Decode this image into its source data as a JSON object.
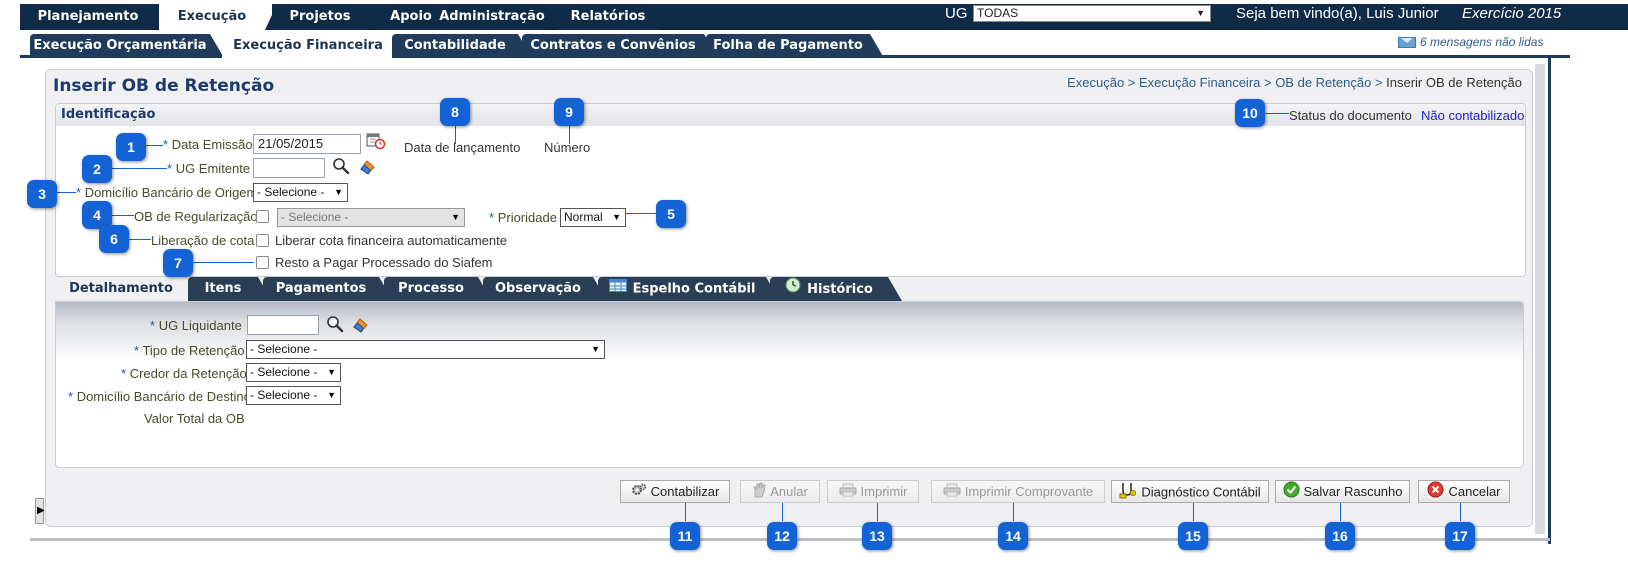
{
  "main_tabs": [
    {
      "label": "Planejamento"
    },
    {
      "label": "Execução",
      "active": true
    },
    {
      "label": "Projetos"
    },
    {
      "label": "Apoio"
    },
    {
      "label": "Administração"
    },
    {
      "label": "Relatórios"
    }
  ],
  "header": {
    "ug_label": "UG",
    "ug_value": "TODAS",
    "welcome": "Seja bem vindo(a), Luis Junior",
    "exercicio": "Exercício 2015",
    "messages": "6 mensagens não lidas"
  },
  "sub_tabs": [
    {
      "label": "Execução Orçamentária"
    },
    {
      "label": "Execução Financeira",
      "active": true
    },
    {
      "label": "Contabilidade"
    },
    {
      "label": "Contratos e Convênios"
    },
    {
      "label": "Folha de Pagamento"
    }
  ],
  "page": {
    "title": "Inserir OB de Retenção",
    "breadcrumb_links": "Execução > Execução Financeira > OB de Retenção > ",
    "breadcrumb_current": "Inserir OB de Retenção"
  },
  "identificacao": {
    "title": "Identificação",
    "data_emissao_label": "Data Emissão",
    "data_emissao_value": "21/05/2015",
    "ug_emitente_label": "UG Emitente",
    "ug_emitente_value": "",
    "domicilio_label": "Domicílio Bancário de Origem",
    "domicilio_value": "- Selecione -",
    "ob_regularizacao_label": "OB de Regularização",
    "ob_regularizacao_value": "- Selecione -",
    "prioridade_label": "Prioridade",
    "prioridade_value": "Normal",
    "liberacao_label": "Liberação de cota",
    "liberacao_text": "Liberar cota financeira automaticamente",
    "resto_text": "Resto a Pagar Processado do Siafem",
    "data_lancamento_label": "Data de lançamento",
    "numero_label": "Número",
    "status_label": "Status do documento",
    "status_value": "Não contabilizado"
  },
  "detail_tabs": [
    {
      "label": "Detalhamento",
      "active": true
    },
    {
      "label": "Itens"
    },
    {
      "label": "Pagamentos"
    },
    {
      "label": "Processo"
    },
    {
      "label": "Observação"
    },
    {
      "label": "Espelho Contábil",
      "icon": "table-icon"
    },
    {
      "label": "Histórico",
      "icon": "history-icon"
    }
  ],
  "detalhamento": {
    "ug_liquidante_label": "UG Liquidante",
    "ug_liquidante_value": "",
    "tipo_retencao_label": "Tipo de Retenção",
    "tipo_retencao_value": "- Selecione -",
    "credor_label": "Credor da Retenção",
    "credor_value": "- Selecione -",
    "domicilio_destino_label": "Domicílio Bancário de Destino",
    "domicilio_destino_value": "- Selecione -",
    "valor_total_label": "Valor Total da OB"
  },
  "buttons": [
    {
      "label": "Contabilizar",
      "enabled": true
    },
    {
      "label": "Anular",
      "enabled": false
    },
    {
      "label": "Imprimir",
      "enabled": false
    },
    {
      "label": "Imprimir Comprovante",
      "enabled": false
    },
    {
      "label": "Diagnóstico Contábil",
      "enabled": true
    },
    {
      "label": "Salvar Rascunho",
      "enabled": true
    },
    {
      "label": "Cancelar",
      "enabled": true
    }
  ],
  "required_mark": "*",
  "callouts": [
    "1",
    "2",
    "3",
    "4",
    "5",
    "6",
    "7",
    "8",
    "9",
    "10",
    "11",
    "12",
    "13",
    "14",
    "15",
    "16",
    "17"
  ],
  "colors": {
    "nav": "#0f2b47",
    "accent": "#1463d6",
    "title": "#1c3a6b",
    "status": "#2323c8"
  }
}
